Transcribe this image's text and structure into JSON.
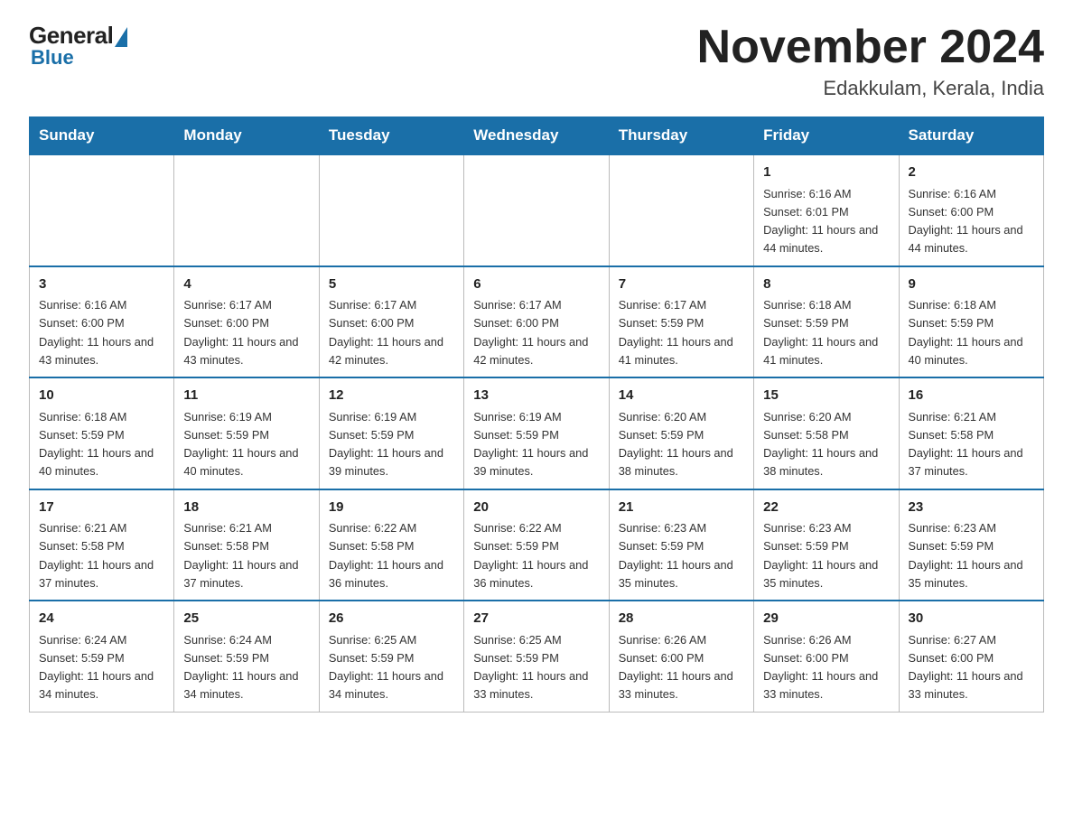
{
  "header": {
    "logo_general": "General",
    "logo_blue": "Blue",
    "month_title": "November 2024",
    "location": "Edakkulam, Kerala, India"
  },
  "days_of_week": [
    "Sunday",
    "Monday",
    "Tuesday",
    "Wednesday",
    "Thursday",
    "Friday",
    "Saturday"
  ],
  "weeks": [
    [
      {
        "day": "",
        "info": ""
      },
      {
        "day": "",
        "info": ""
      },
      {
        "day": "",
        "info": ""
      },
      {
        "day": "",
        "info": ""
      },
      {
        "day": "",
        "info": ""
      },
      {
        "day": "1",
        "info": "Sunrise: 6:16 AM\nSunset: 6:01 PM\nDaylight: 11 hours\nand 44 minutes."
      },
      {
        "day": "2",
        "info": "Sunrise: 6:16 AM\nSunset: 6:00 PM\nDaylight: 11 hours\nand 44 minutes."
      }
    ],
    [
      {
        "day": "3",
        "info": "Sunrise: 6:16 AM\nSunset: 6:00 PM\nDaylight: 11 hours\nand 43 minutes."
      },
      {
        "day": "4",
        "info": "Sunrise: 6:17 AM\nSunset: 6:00 PM\nDaylight: 11 hours\nand 43 minutes."
      },
      {
        "day": "5",
        "info": "Sunrise: 6:17 AM\nSunset: 6:00 PM\nDaylight: 11 hours\nand 42 minutes."
      },
      {
        "day": "6",
        "info": "Sunrise: 6:17 AM\nSunset: 6:00 PM\nDaylight: 11 hours\nand 42 minutes."
      },
      {
        "day": "7",
        "info": "Sunrise: 6:17 AM\nSunset: 5:59 PM\nDaylight: 11 hours\nand 41 minutes."
      },
      {
        "day": "8",
        "info": "Sunrise: 6:18 AM\nSunset: 5:59 PM\nDaylight: 11 hours\nand 41 minutes."
      },
      {
        "day": "9",
        "info": "Sunrise: 6:18 AM\nSunset: 5:59 PM\nDaylight: 11 hours\nand 40 minutes."
      }
    ],
    [
      {
        "day": "10",
        "info": "Sunrise: 6:18 AM\nSunset: 5:59 PM\nDaylight: 11 hours\nand 40 minutes."
      },
      {
        "day": "11",
        "info": "Sunrise: 6:19 AM\nSunset: 5:59 PM\nDaylight: 11 hours\nand 40 minutes."
      },
      {
        "day": "12",
        "info": "Sunrise: 6:19 AM\nSunset: 5:59 PM\nDaylight: 11 hours\nand 39 minutes."
      },
      {
        "day": "13",
        "info": "Sunrise: 6:19 AM\nSunset: 5:59 PM\nDaylight: 11 hours\nand 39 minutes."
      },
      {
        "day": "14",
        "info": "Sunrise: 6:20 AM\nSunset: 5:59 PM\nDaylight: 11 hours\nand 38 minutes."
      },
      {
        "day": "15",
        "info": "Sunrise: 6:20 AM\nSunset: 5:58 PM\nDaylight: 11 hours\nand 38 minutes."
      },
      {
        "day": "16",
        "info": "Sunrise: 6:21 AM\nSunset: 5:58 PM\nDaylight: 11 hours\nand 37 minutes."
      }
    ],
    [
      {
        "day": "17",
        "info": "Sunrise: 6:21 AM\nSunset: 5:58 PM\nDaylight: 11 hours\nand 37 minutes."
      },
      {
        "day": "18",
        "info": "Sunrise: 6:21 AM\nSunset: 5:58 PM\nDaylight: 11 hours\nand 37 minutes."
      },
      {
        "day": "19",
        "info": "Sunrise: 6:22 AM\nSunset: 5:58 PM\nDaylight: 11 hours\nand 36 minutes."
      },
      {
        "day": "20",
        "info": "Sunrise: 6:22 AM\nSunset: 5:59 PM\nDaylight: 11 hours\nand 36 minutes."
      },
      {
        "day": "21",
        "info": "Sunrise: 6:23 AM\nSunset: 5:59 PM\nDaylight: 11 hours\nand 35 minutes."
      },
      {
        "day": "22",
        "info": "Sunrise: 6:23 AM\nSunset: 5:59 PM\nDaylight: 11 hours\nand 35 minutes."
      },
      {
        "day": "23",
        "info": "Sunrise: 6:23 AM\nSunset: 5:59 PM\nDaylight: 11 hours\nand 35 minutes."
      }
    ],
    [
      {
        "day": "24",
        "info": "Sunrise: 6:24 AM\nSunset: 5:59 PM\nDaylight: 11 hours\nand 34 minutes."
      },
      {
        "day": "25",
        "info": "Sunrise: 6:24 AM\nSunset: 5:59 PM\nDaylight: 11 hours\nand 34 minutes."
      },
      {
        "day": "26",
        "info": "Sunrise: 6:25 AM\nSunset: 5:59 PM\nDaylight: 11 hours\nand 34 minutes."
      },
      {
        "day": "27",
        "info": "Sunrise: 6:25 AM\nSunset: 5:59 PM\nDaylight: 11 hours\nand 33 minutes."
      },
      {
        "day": "28",
        "info": "Sunrise: 6:26 AM\nSunset: 6:00 PM\nDaylight: 11 hours\nand 33 minutes."
      },
      {
        "day": "29",
        "info": "Sunrise: 6:26 AM\nSunset: 6:00 PM\nDaylight: 11 hours\nand 33 minutes."
      },
      {
        "day": "30",
        "info": "Sunrise: 6:27 AM\nSunset: 6:00 PM\nDaylight: 11 hours\nand 33 minutes."
      }
    ]
  ]
}
